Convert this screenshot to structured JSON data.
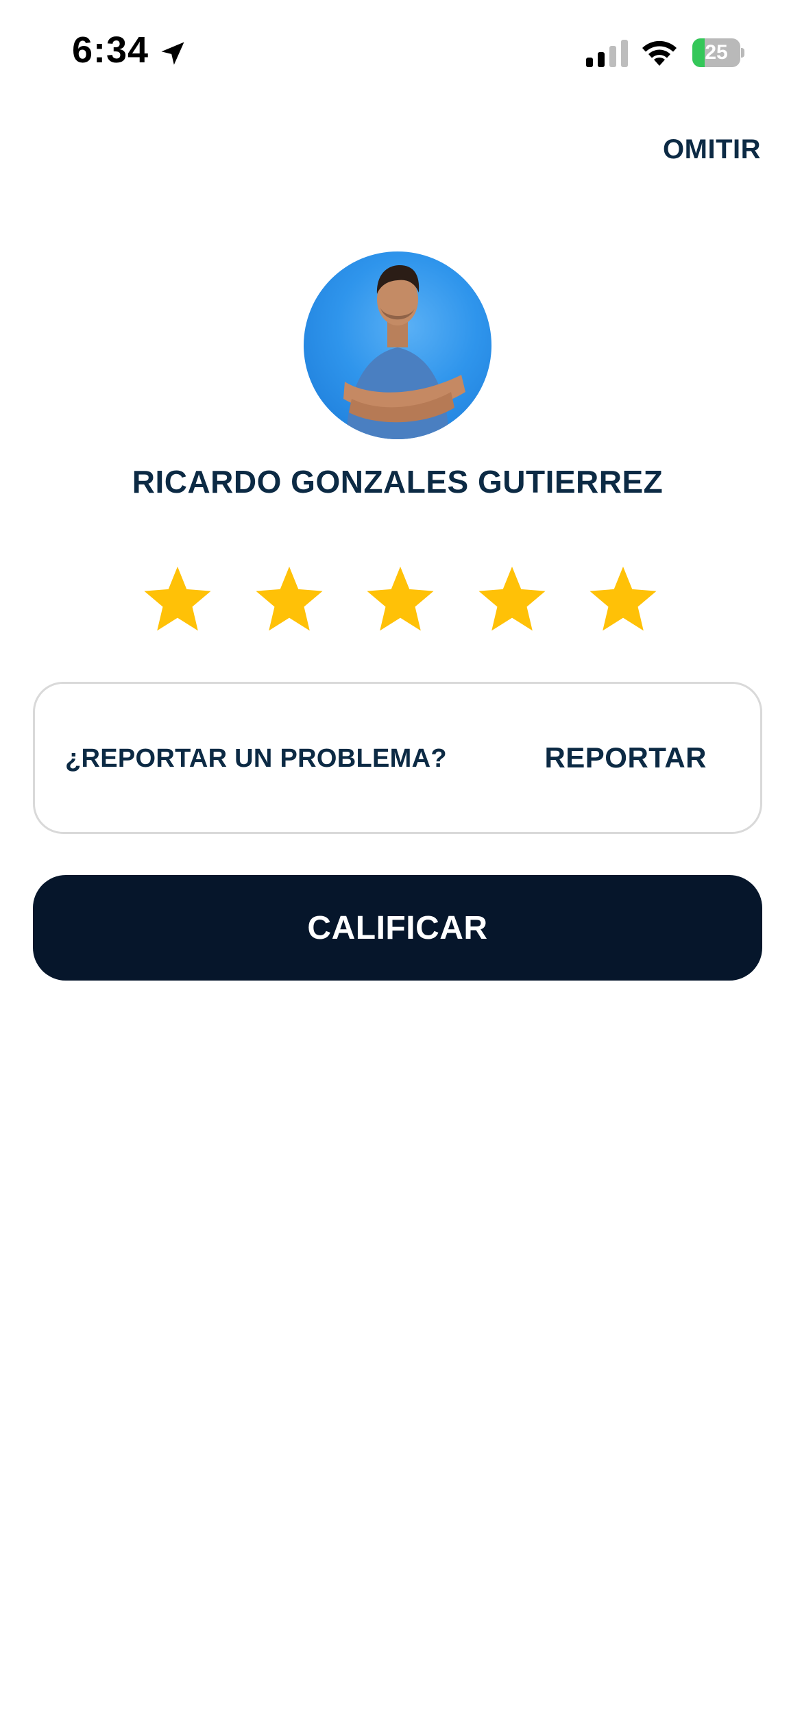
{
  "status_bar": {
    "time": "6:34",
    "battery_level": "25",
    "battery_fraction": 0.25,
    "icons": [
      "location-arrow-icon",
      "cellular-signal-icon",
      "wifi-icon",
      "battery-charging-icon"
    ]
  },
  "header": {
    "skip_label": "OMITIR"
  },
  "profile": {
    "name": "RICARDO GONZALES GUTIERREZ"
  },
  "rating": {
    "stars_filled": 5,
    "stars_total": 5,
    "star_color": "#FFC107"
  },
  "report": {
    "question": "¿REPORTAR UN PROBLEMA?",
    "button_label": "REPORTAR"
  },
  "actions": {
    "rate_label": "CALIFICAR"
  },
  "colors": {
    "text_primary": "#0C2A44",
    "button_bg": "#06162B",
    "card_border": "#D9D9D9",
    "battery_green": "#34C759"
  }
}
